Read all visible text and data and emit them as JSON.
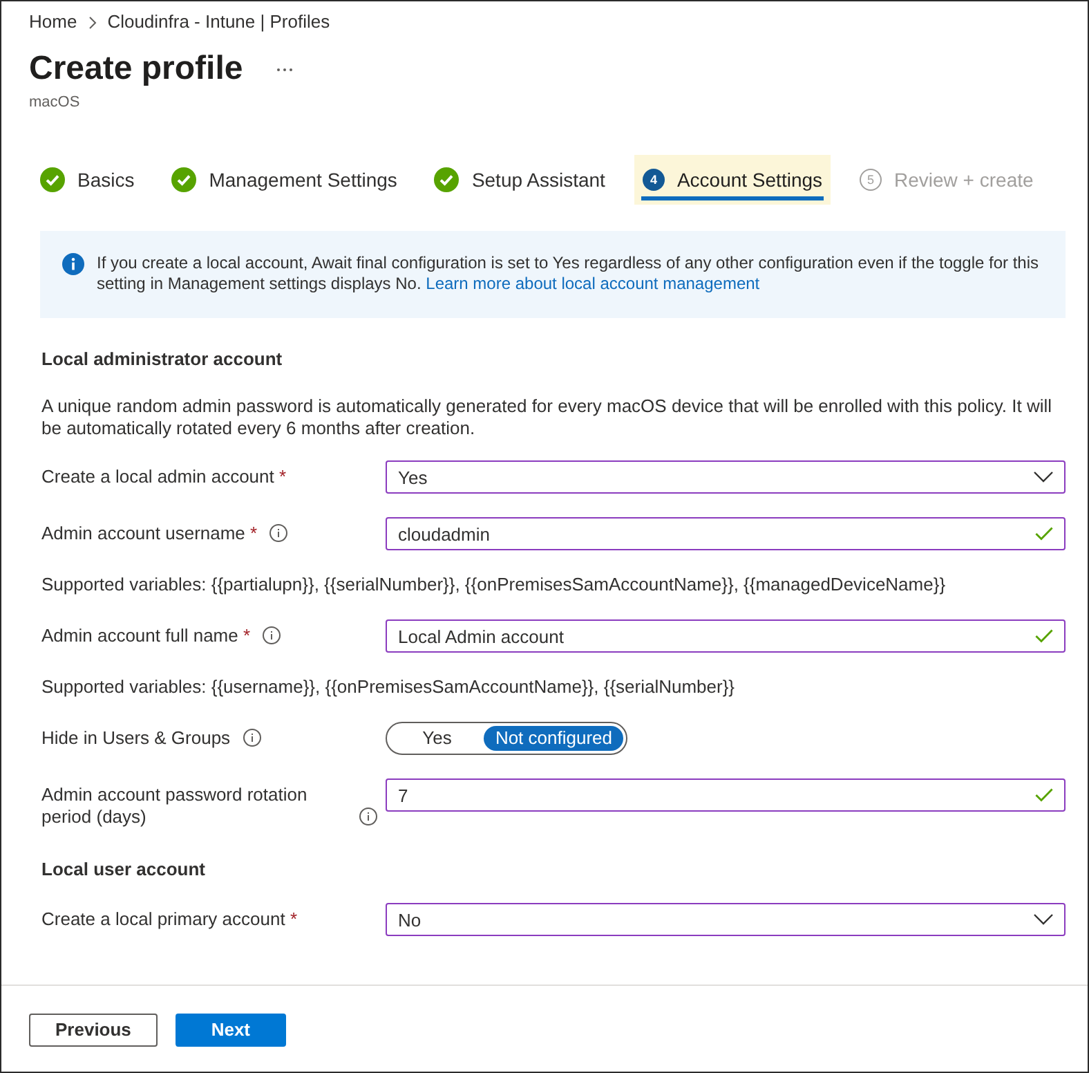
{
  "breadcrumb": [
    {
      "label": "Home"
    },
    {
      "label": "Cloudinfra - Intune | Profiles"
    }
  ],
  "page": {
    "title": "Create profile",
    "subtitle": "macOS"
  },
  "steps": [
    {
      "label": "Basics",
      "completed": true,
      "disabled": false,
      "selected": false
    },
    {
      "label": "Management Settings",
      "completed": true,
      "disabled": false,
      "selected": false
    },
    {
      "label": "Setup Assistant",
      "completed": true,
      "disabled": false,
      "selected": false
    },
    {
      "label": "Account Settings",
      "number": "4",
      "completed": false,
      "disabled": false,
      "selected": true
    },
    {
      "label": "Review + create",
      "number": "5",
      "completed": false,
      "disabled": true,
      "selected": false
    }
  ],
  "info_banner": {
    "text": "If you create a local account, Await final configuration is set to Yes regardless of any other configuration even if the toggle for this setting in Management settings displays No.",
    "link": "Learn more about local account management"
  },
  "sections": [
    {
      "heading": "Local administrator account",
      "description": "A unique random admin password is automatically generated for every macOS device that will be enrolled with this policy. It will be automatically rotated every 6 months after creation.",
      "fields": [
        {
          "kind": "dropdown",
          "label": "Create a local admin account",
          "required_mark": "*",
          "value": "Yes"
        },
        {
          "kind": "text",
          "label": "Admin account username",
          "required_mark": "*",
          "info": true,
          "value": "cloudadmin",
          "valid": true
        },
        {
          "kind": "note",
          "text": "Supported variables: {{partialupn}}, {{serialNumber}}, {{onPremisesSamAccountName}}, {{managedDeviceName}}"
        },
        {
          "kind": "text",
          "label": "Admin account full name",
          "required_mark": "*",
          "info": true,
          "value": "Local Admin account",
          "valid": true
        },
        {
          "kind": "note",
          "text": "Supported variables: {{username}}, {{onPremisesSamAccountName}}, {{serialNumber}}"
        },
        {
          "kind": "toggle",
          "label": "Hide in Users & Groups",
          "info": true,
          "options": [
            {
              "label": "Yes",
              "selected": false
            },
            {
              "label": "Not configured",
              "selected": true
            }
          ]
        },
        {
          "kind": "text",
          "label": "Admin account password rotation period (days)",
          "info": true,
          "value": "7",
          "valid": true
        }
      ]
    },
    {
      "heading": "Local user account",
      "fields": [
        {
          "kind": "dropdown",
          "label": "Create a local primary account",
          "required_mark": "*",
          "value": "No"
        }
      ]
    }
  ],
  "footer": {
    "buttons": [
      {
        "label": "Previous",
        "kind": "secondary"
      },
      {
        "label": "Next",
        "kind": "primary"
      }
    ]
  }
}
